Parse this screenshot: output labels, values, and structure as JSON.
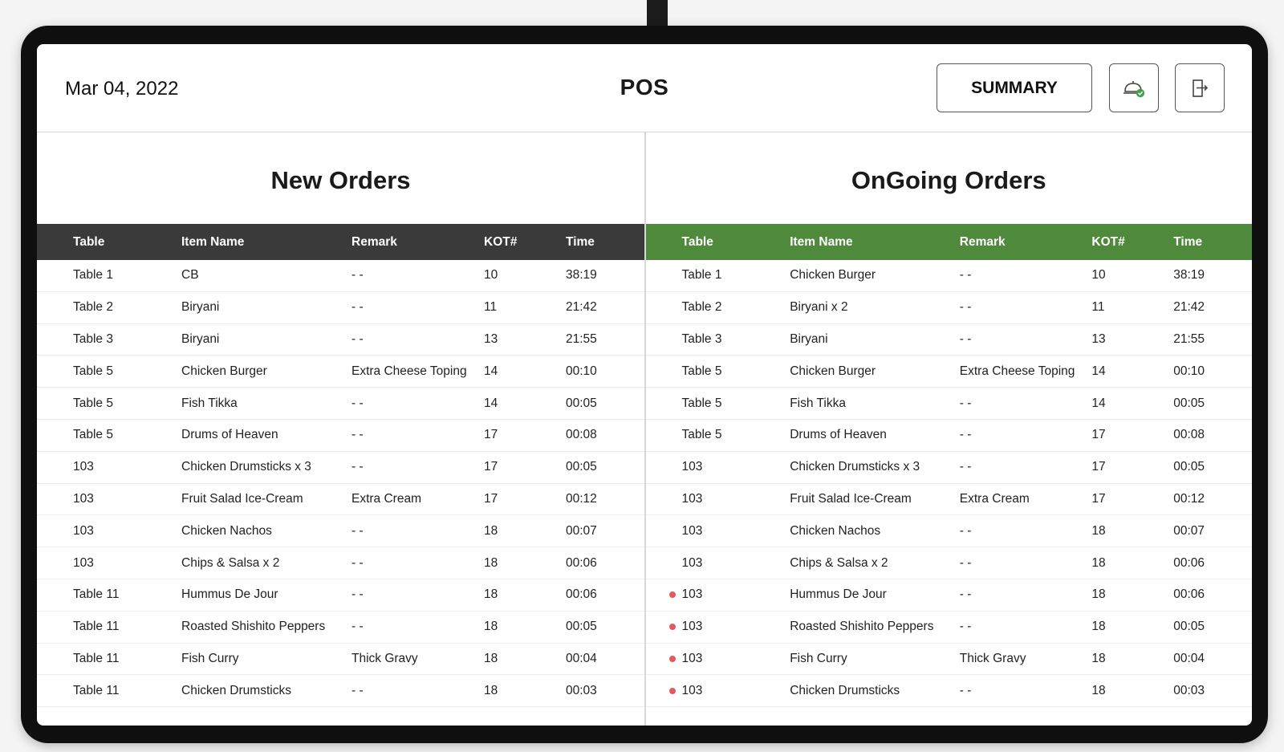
{
  "header": {
    "date": "Mar 04, 2022",
    "title": "POS",
    "summary_label": "SUMMARY",
    "serve_icon": "food-cloche-check-icon",
    "exit_icon": "exit-door-icon"
  },
  "colors": {
    "new_header_bg": "#3a3a3a",
    "ongoing_header_bg": "#4f8a3c",
    "alert_dot": "#e05b5b"
  },
  "new_orders": {
    "title": "New Orders",
    "columns": [
      "Table",
      "Item Name",
      "Remark",
      "KOT#",
      "Time"
    ],
    "rows": [
      {
        "table": "Table 1",
        "item": "CB",
        "remark": "- -",
        "kot": "10",
        "time": "38:19"
      },
      {
        "table": "Table 2",
        "item": "Biryani",
        "remark": "- -",
        "kot": "11",
        "time": "21:42"
      },
      {
        "table": "Table 3",
        "item": "Biryani",
        "remark": "- -",
        "kot": "13",
        "time": "21:55"
      },
      {
        "table": "Table 5",
        "item": "Chicken Burger",
        "remark": "Extra Cheese Toping",
        "kot": "14",
        "time": "00:10"
      },
      {
        "table": "Table 5",
        "item": "Fish Tikka",
        "remark": "- -",
        "kot": "14",
        "time": "00:05"
      },
      {
        "table": "Table 5",
        "item": "Drums of Heaven",
        "remark": "- -",
        "kot": "17",
        "time": "00:08"
      },
      {
        "table": "103",
        "item": "Chicken Drumsticks x 3",
        "remark": "- -",
        "kot": "17",
        "time": "00:05"
      },
      {
        "table": "103",
        "item": "Fruit Salad Ice-Cream",
        "remark": "Extra Cream",
        "kot": "17",
        "time": "00:12"
      },
      {
        "table": "103",
        "item": "Chicken Nachos",
        "remark": "- -",
        "kot": "18",
        "time": "00:07"
      },
      {
        "table": "103",
        "item": "Chips & Salsa x 2",
        "remark": "- -",
        "kot": "18",
        "time": "00:06"
      },
      {
        "table": "Table 11",
        "item": "Hummus De Jour",
        "remark": "- -",
        "kot": "18",
        "time": "00:06"
      },
      {
        "table": "Table 11",
        "item": "Roasted Shishito Peppers",
        "remark": "- -",
        "kot": "18",
        "time": "00:05"
      },
      {
        "table": "Table 11",
        "item": "Fish Curry",
        "remark": "Thick Gravy",
        "kot": "18",
        "time": "00:04"
      },
      {
        "table": "Table 11",
        "item": "Chicken Drumsticks",
        "remark": "- -",
        "kot": "18",
        "time": "00:03"
      }
    ]
  },
  "ongoing_orders": {
    "title": "OnGoing Orders",
    "columns": [
      "Table",
      "Item Name",
      "Remark",
      "KOT#",
      "Time"
    ],
    "rows": [
      {
        "table": "Table 1",
        "item": "Chicken Burger",
        "remark": "- -",
        "kot": "10",
        "time": "38:19",
        "alert": false
      },
      {
        "table": "Table 2",
        "item": "Biryani x 2",
        "remark": "- -",
        "kot": "11",
        "time": "21:42",
        "alert": false
      },
      {
        "table": "Table 3",
        "item": "Biryani",
        "remark": "- -",
        "kot": "13",
        "time": "21:55",
        "alert": false
      },
      {
        "table": "Table 5",
        "item": "Chicken Burger",
        "remark": "Extra Cheese Toping",
        "kot": "14",
        "time": "00:10",
        "alert": false
      },
      {
        "table": "Table 5",
        "item": "Fish Tikka",
        "remark": "- -",
        "kot": "14",
        "time": "00:05",
        "alert": false
      },
      {
        "table": "Table 5",
        "item": "Drums of Heaven",
        "remark": "- -",
        "kot": "17",
        "time": "00:08",
        "alert": false
      },
      {
        "table": "103",
        "item": "Chicken Drumsticks x 3",
        "remark": "- -",
        "kot": "17",
        "time": "00:05",
        "alert": false
      },
      {
        "table": "103",
        "item": "Fruit Salad Ice-Cream",
        "remark": "Extra Cream",
        "kot": "17",
        "time": "00:12",
        "alert": false
      },
      {
        "table": "103",
        "item": "Chicken Nachos",
        "remark": "- -",
        "kot": "18",
        "time": "00:07",
        "alert": false
      },
      {
        "table": "103",
        "item": "Chips & Salsa x 2",
        "remark": "- -",
        "kot": "18",
        "time": "00:06",
        "alert": false
      },
      {
        "table": "103",
        "item": "Hummus De Jour",
        "remark": "- -",
        "kot": "18",
        "time": "00:06",
        "alert": true
      },
      {
        "table": "103",
        "item": "Roasted Shishito Peppers",
        "remark": "- -",
        "kot": "18",
        "time": "00:05",
        "alert": true
      },
      {
        "table": "103",
        "item": "Fish Curry",
        "remark": "Thick Gravy",
        "kot": "18",
        "time": "00:04",
        "alert": true
      },
      {
        "table": "103",
        "item": "Chicken Drumsticks",
        "remark": "- -",
        "kot": "18",
        "time": "00:03",
        "alert": true
      }
    ]
  }
}
